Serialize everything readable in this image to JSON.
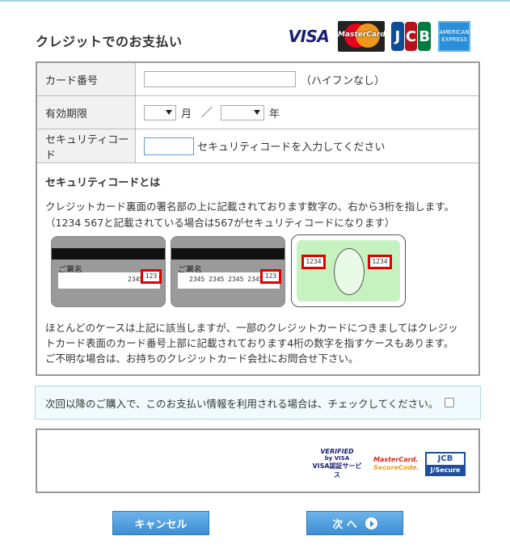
{
  "page": {
    "title": "クレジットでのお支払い"
  },
  "brands": {
    "visa": "VISA",
    "mastercard": "MasterCard",
    "jcb": [
      "J",
      "C",
      "B"
    ],
    "amex_line1": "AMERICAN",
    "amex_line2": "EXPRESS"
  },
  "form": {
    "card_number_label": "カード番号",
    "card_number_value": "",
    "card_number_note": "（ハイフンなし）",
    "expiry_label": "有効期限",
    "expiry_month_value": "",
    "expiry_month_unit": "月",
    "expiry_separator": "／",
    "expiry_year_value": "",
    "expiry_year_unit": "年",
    "security_label": "セキュリティコード",
    "security_value": "",
    "security_note": "セキュリティコードを入力してください"
  },
  "explain": {
    "title": "セキュリティコードとは",
    "line1": "クレジットカード裏面の署名部の上に記載されております数字の、右から3桁を指します。",
    "line2": "（1234 567と記載されている場合は567がセキュリティコードになります）",
    "card1_sig": "ご署名",
    "card1_num": "2345",
    "card1_code": "123",
    "card2_sig": "ご署名",
    "card2_num": "2345 2345 2345 2345",
    "card2_code": "123",
    "card3_left": "1234",
    "card3_right": "1234",
    "para2_line1": "ほとんどのケースは上記に該当しますが、一部のクレジットカードにつきましてはクレジッ",
    "para2_line2": "トカード表面のカード番号上部に記載されております4桁の数字を指すケースもあります。",
    "para2_line3": "ご不明な場合は、お持ちのクレジットカード会社にお問合せ下さい。"
  },
  "save": {
    "label": "次回以降のご購入で、このお支払い情報を利用される場合は、チェックしてください。",
    "checked": false
  },
  "secure": {
    "vbv_line1": "VERIFIED",
    "vbv_line2": "by VISA",
    "vbv_line3": "VISA認証サービス",
    "mc_line1": "MasterCard.",
    "mc_line2": "SecureCode.",
    "jcb_top": "JCB",
    "jcb_bottom": "J/Secure"
  },
  "buttons": {
    "cancel": "キャンセル",
    "next": "次 へ"
  }
}
